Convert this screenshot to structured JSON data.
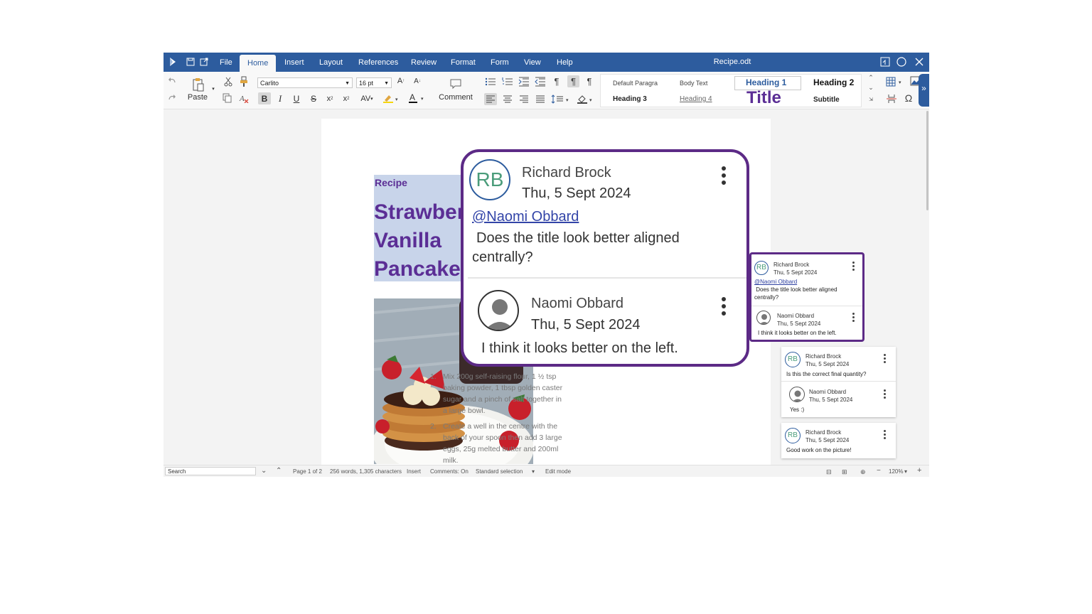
{
  "app": {
    "doc_title": "Recipe.odt",
    "menu": [
      "File",
      "Home",
      "Insert",
      "Layout",
      "References",
      "Review",
      "Format",
      "Form",
      "View",
      "Help"
    ],
    "active_menu": "Home",
    "accent": "#2d5c9e"
  },
  "ribbon": {
    "paste_label": "Paste",
    "comment_label": "Comment",
    "font_name": "Carlito",
    "font_size": "16 pt",
    "styles": {
      "default_para": "Default Paragra",
      "body_text": "Body Text",
      "heading1": "Heading 1",
      "heading2": "Heading 2",
      "heading3": "Heading 3",
      "heading4": "Heading 4",
      "title": "Title",
      "subtitle": "Subtitle"
    }
  },
  "document": {
    "recipe_label": "Recipe",
    "title_lines": [
      "Strawber",
      "Vanilla",
      "Pancakes"
    ],
    "steps": [
      {
        "num": "1.",
        "text": "Mix 200g self-raising flour, 1 ½ tsp baking powder, 1 tbsp golden caster sugar and a pinch of salt together in a large bowl."
      },
      {
        "num": "2.",
        "text": "Create a well in the centre with the back of your spoon then add 3 large eggs, 25g melted butter and 200ml milk."
      }
    ],
    "title_color": "#5b2e95"
  },
  "comments": {
    "highlight_color": "#5c2a86",
    "big": {
      "author1_initials": "RB",
      "author1": "Richard Brock",
      "date1": "Thu, 5 Sept 2024",
      "mention": "@Naomi Obbard",
      "text1": "Does the title look better aligned centrally?",
      "author2": "Naomi Obbard",
      "date2": "Thu, 5 Sept 2024",
      "text2": "I think it looks better on the left."
    },
    "mid": {
      "initials": "RB",
      "author1": "Richard Brock",
      "date1": "Thu, 5 Sept 2024",
      "mention": "@Naomi Obbard",
      "text1a": " Does the title look better aligned",
      "text1b": "centrally?",
      "author2": "Naomi Obbard",
      "date2": "Thu, 5 Sept 2024",
      "text2": "I think it looks better on the left."
    },
    "card2": {
      "initials": "RB",
      "author1": "Richard Brock",
      "date1": "Thu, 5 Sept 2024",
      "text1": "Is this the correct final quantity?",
      "author2": "Naomi Obbard",
      "date2": "Thu, 5 Sept 2024",
      "text2": "Yes :)"
    },
    "card3": {
      "initials": "RB",
      "author": "Richard Brock",
      "date": "Thu, 5 Sept 2024",
      "text": "Good work on the picture!"
    }
  },
  "status": {
    "search_placeholder": "Search",
    "page": "Page 1 of 2",
    "words": "256 words, 1,305 characters",
    "mode": "Insert",
    "comments": "Comments: On",
    "selection": "Standard selection",
    "edit": "Edit mode",
    "zoom": "120%"
  }
}
